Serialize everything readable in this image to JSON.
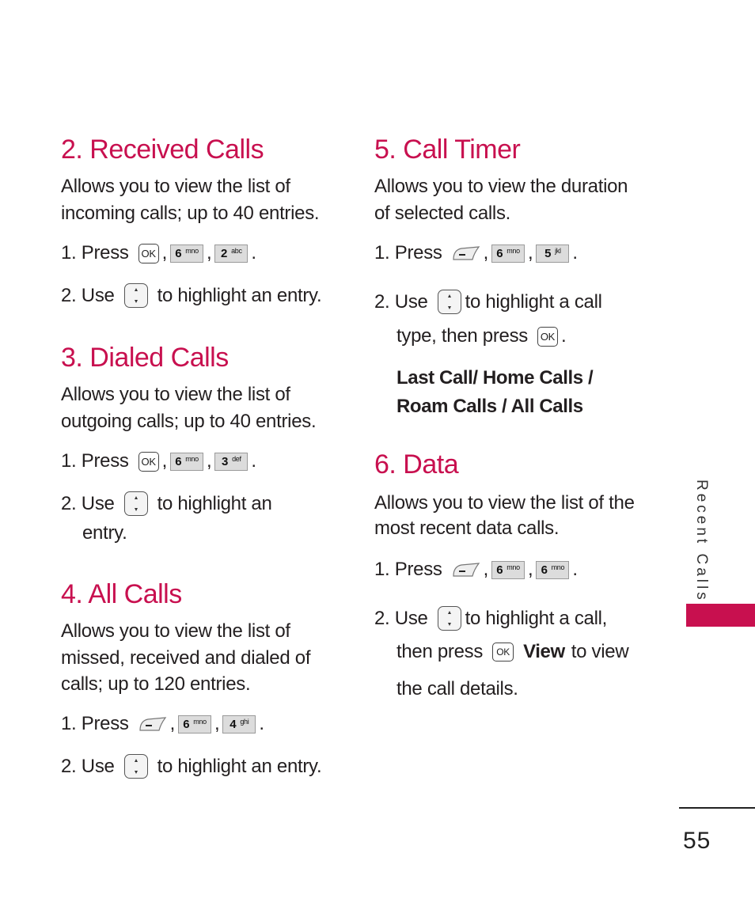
{
  "page": {
    "side_tab_label": "Recent Calls",
    "page_number": "55",
    "accent_color": "#c8104f"
  },
  "sections": {
    "received": {
      "title": "2. Received Calls",
      "desc": [
        "Allows you to view the list of",
        "incoming calls; up to 40 entries."
      ],
      "step1_prefix": "1. Press",
      "step1_keys": [
        {
          "icon": "ok-key-icon",
          "label": "OK"
        },
        {
          "icon": "key-6-icon",
          "num": "6",
          "sub": "mno"
        },
        {
          "icon": "key-2-icon",
          "num": "2",
          "sub": "abc"
        }
      ],
      "step2_prefix": "2. Use",
      "step2_suffix": "to highlight an entry."
    },
    "dialed": {
      "title": "3. Dialed Calls",
      "desc": [
        "Allows you to view the list of",
        "outgoing calls; up to 40 entries."
      ],
      "step1_prefix": "1. Press",
      "step1_keys": [
        {
          "icon": "ok-key-icon",
          "label": "OK"
        },
        {
          "icon": "key-6-icon",
          "num": "6",
          "sub": "mno"
        },
        {
          "icon": "key-3-icon",
          "num": "3",
          "sub": "def"
        }
      ],
      "step2_prefix": "2.  Use",
      "step2_suffix": "to highlight an",
      "step2_cont": "entry."
    },
    "all": {
      "title": "4. All Calls",
      "desc": [
        "Allows you to view the list of",
        "missed, received and dialed of",
        "calls; up to 120 entries."
      ],
      "step1_prefix": "1. Press",
      "step1_keys": [
        {
          "icon": "left-soft-key-icon"
        },
        {
          "icon": "key-6-icon",
          "num": "6",
          "sub": "mno"
        },
        {
          "icon": "key-4-icon",
          "num": "4",
          "sub": "ghi"
        }
      ],
      "step2_prefix": "2. Use",
      "step2_suffix": "to highlight an entry."
    },
    "timer": {
      "title": "5. Call Timer",
      "desc": [
        "Allows you to view the duration",
        "of selected calls."
      ],
      "step1_prefix": "1. Press",
      "step1_keys": [
        {
          "icon": "left-soft-key-icon"
        },
        {
          "icon": "key-6-icon",
          "num": "6",
          "sub": "mno"
        },
        {
          "icon": "key-5-icon",
          "num": "5",
          "sub": "jkl"
        }
      ],
      "step2_prefix": "2. Use",
      "step2_suffix": "to highlight a call",
      "step2_cont_prefix": "type, then press",
      "options": [
        "Last Call/ Home Calls /",
        "Roam Calls / All Calls"
      ]
    },
    "data": {
      "title": "6. Data",
      "desc": [
        "Allows you to view the list of the",
        "most recent data calls."
      ],
      "step1_prefix": "1. Press",
      "step1_keys": [
        {
          "icon": "left-soft-key-icon"
        },
        {
          "icon": "key-6-icon",
          "num": "6",
          "sub": "mno"
        },
        {
          "icon": "key-6-icon",
          "num": "6",
          "sub": "mno"
        }
      ],
      "step2_prefix": "2. Use",
      "step2_suffix": "to highlight a call,",
      "step2_cont_prefix": "then press",
      "step2_cont_bold": "View",
      "step2_cont_suffix": "to view",
      "step2_cont2": "the call details."
    }
  },
  "keys": {
    "ok": "OK",
    "comma": ",",
    "period": "."
  }
}
